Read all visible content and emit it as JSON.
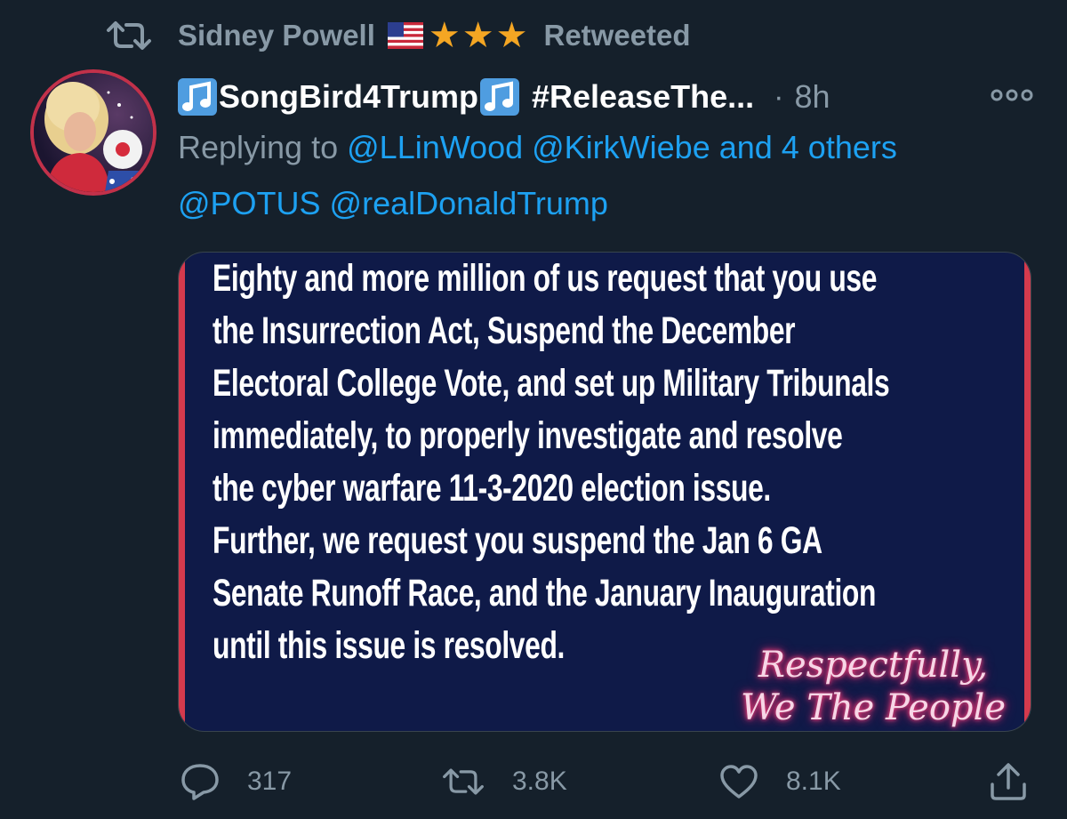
{
  "retweet_header": {
    "retweeter_name": "Sidney Powell",
    "stars": "★★★",
    "label": "Retweeted"
  },
  "tweet": {
    "display_name": "SongBird4Trump",
    "display_name_suffix": "#ReleaseThe...",
    "separator": "·",
    "timestamp": "8h",
    "replying_prefix": "Replying to",
    "replying_mentions": "@LLinWood @KirkWiebe and 4 others",
    "mentions_line": "@POTUS @realDonaldTrump"
  },
  "media": {
    "text": "Eighty and more million of us request that you use\nthe Insurrection Act, Suspend the December\nElectoral College Vote, and set up Military Tribunals\nimmediately, to properly investigate and resolve\nthe cyber warfare 11-3-2020 election issue.\nFurther, we request you suspend the Jan 6 GA\nSenate Runoff Race, and the January Inauguration\nuntil this issue is resolved.",
    "signature_line1": "Respectfully,",
    "signature_line2": "We The People"
  },
  "actions": {
    "replies": "317",
    "retweets": "3.8K",
    "likes": "8.1K"
  },
  "icons": {
    "retweet_header_icon": "retweet-icon",
    "flag": "us-flag-icon",
    "note": "music-note-icon",
    "more": "more-icon",
    "reply": "reply-icon",
    "retweet": "retweet-icon",
    "like": "heart-icon",
    "share": "share-icon"
  },
  "colors": {
    "background": "#15202b",
    "muted_text": "#8899a6",
    "link_blue": "#1da1f2",
    "star_gold": "#f4a623",
    "media_background": "#0f1a48",
    "media_stripe": "#d43a4d",
    "signature_glow": "#e83f7a"
  }
}
